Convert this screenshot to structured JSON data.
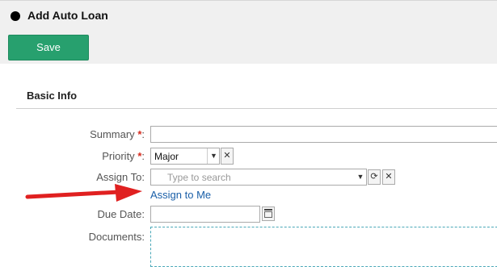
{
  "page": {
    "title": "Add Auto Loan"
  },
  "toolbar": {
    "save_label": "Save"
  },
  "section": {
    "title": "Basic Info"
  },
  "form": {
    "summary": {
      "label": "Summary",
      "required_mark": "*",
      "colon": ":",
      "value": ""
    },
    "priority": {
      "label": "Priority",
      "required_mark": "*",
      "colon": ":",
      "value": "Major"
    },
    "assign_to": {
      "label": "Assign To:",
      "placeholder": "Type to search",
      "link": "Assign to Me"
    },
    "due_date": {
      "label": "Due Date:",
      "value": ""
    },
    "documents": {
      "label": "Documents:"
    }
  },
  "icons": {
    "title_bullet": "filled-circle-icon",
    "dropdown": "chevron-down-icon",
    "clear": "close-icon",
    "refresh": "refresh-icon",
    "calendar": "calendar-icon"
  },
  "colors": {
    "primary": "#27a06e",
    "link": "#1a5fa8",
    "required": "#d52b1e",
    "annotation_arrow": "#e02020"
  }
}
